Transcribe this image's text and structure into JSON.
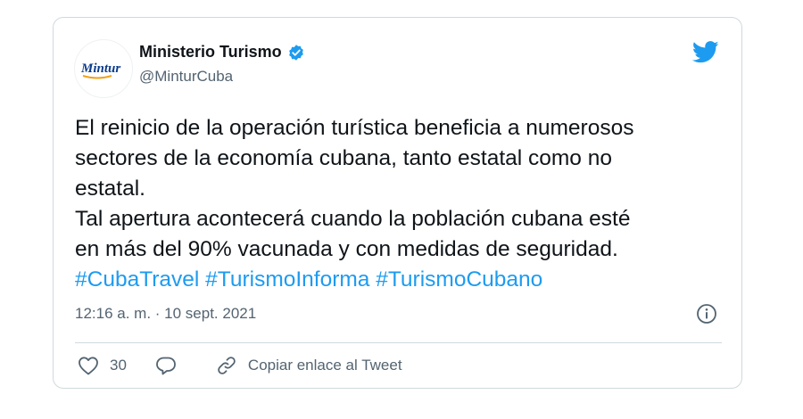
{
  "colors": {
    "accent": "#1d9bf0",
    "text": "#0f1419",
    "secondary": "#536471",
    "border": "#cfd9de"
  },
  "author": {
    "avatar_logo_text": "Mintur",
    "name": "Ministerio Turismo",
    "handle": "@MinturCuba",
    "verified": true
  },
  "tweet": {
    "lines": [
      "El reinicio de la operación turística beneficia a numerosos",
      "sectores de la economía cubana, tanto estatal como no",
      "estatal.",
      "Tal apertura acontecerá cuando la población cubana esté",
      "en más del 90% vacunada y con medidas de seguridad."
    ],
    "hashtags": [
      "#CubaTravel",
      "#TurismoInforma",
      "#TurismoCubano"
    ],
    "timestamp": "12:16 a. m. · 10 sept. 2021"
  },
  "actions": {
    "like_count": "30",
    "copy_link_label": "Copiar enlace al Tweet"
  },
  "icons": {
    "verified": "verified-badge-icon",
    "brand": "twitter-bird-icon",
    "info": "info-icon",
    "like": "heart-icon",
    "reply": "reply-bubble-icon",
    "copy": "link-icon"
  }
}
